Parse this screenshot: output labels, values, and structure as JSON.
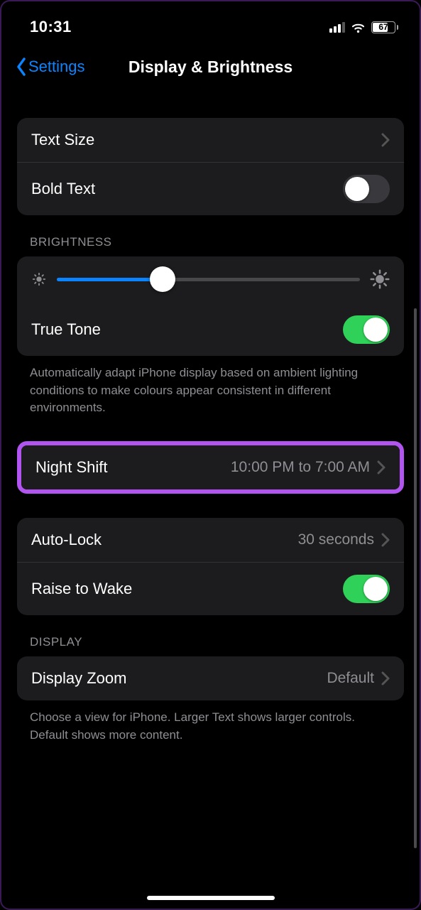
{
  "status": {
    "time": "10:31",
    "battery_pct": "67"
  },
  "nav": {
    "back_label": "Settings",
    "title": "Display & Brightness"
  },
  "text_group": {
    "text_size": "Text Size",
    "bold_text": "Bold Text"
  },
  "brightness": {
    "header": "BRIGHTNESS",
    "true_tone": "True Tone",
    "footer": "Automatically adapt iPhone display based on ambient lighting conditions to make colours appear consistent in different environments."
  },
  "night_shift": {
    "label": "Night Shift",
    "value": "10:00 PM to 7:00 AM"
  },
  "lock_group": {
    "auto_lock": "Auto-Lock",
    "auto_lock_value": "30 seconds",
    "raise_to_wake": "Raise to Wake"
  },
  "display": {
    "header": "DISPLAY",
    "display_zoom": "Display Zoom",
    "display_zoom_value": "Default",
    "footer": "Choose a view for iPhone. Larger Text shows larger controls. Default shows more content."
  }
}
